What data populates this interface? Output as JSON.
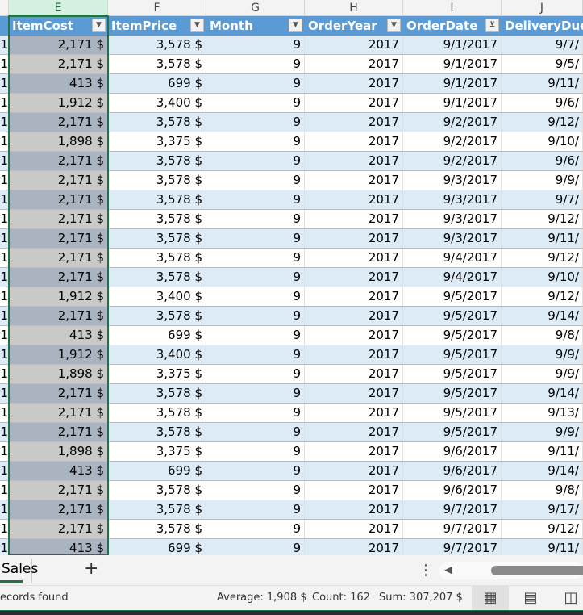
{
  "columns": [
    "",
    "E",
    "F",
    "G",
    "H",
    "I",
    "J"
  ],
  "headers": [
    "",
    "ItemCost",
    "ItemPrice",
    "Month",
    "OrderYear",
    "OrderDate",
    "DeliveryDueD"
  ],
  "filter_icons": [
    "dropdown-icon",
    "dropdown-icon",
    "dropdown-icon",
    "dropdown-icon",
    "filter-active-icon"
  ],
  "rows": [
    [
      "1",
      "2,171 $",
      "3,578 $",
      "9",
      "2017",
      "9/1/2017",
      "9/7/"
    ],
    [
      "1",
      "2,171 $",
      "3,578 $",
      "9",
      "2017",
      "9/1/2017",
      "9/5/"
    ],
    [
      "1",
      "413 $",
      "699 $",
      "9",
      "2017",
      "9/1/2017",
      "9/11/"
    ],
    [
      "1",
      "1,912 $",
      "3,400 $",
      "9",
      "2017",
      "9/1/2017",
      "9/6/"
    ],
    [
      "1",
      "2,171 $",
      "3,578 $",
      "9",
      "2017",
      "9/2/2017",
      "9/12/"
    ],
    [
      "1",
      "1,898 $",
      "3,375 $",
      "9",
      "2017",
      "9/2/2017",
      "9/10/"
    ],
    [
      "1",
      "2,171 $",
      "3,578 $",
      "9",
      "2017",
      "9/2/2017",
      "9/6/"
    ],
    [
      "1",
      "2,171 $",
      "3,578 $",
      "9",
      "2017",
      "9/3/2017",
      "9/9/"
    ],
    [
      "1",
      "2,171 $",
      "3,578 $",
      "9",
      "2017",
      "9/3/2017",
      "9/7/"
    ],
    [
      "1",
      "2,171 $",
      "3,578 $",
      "9",
      "2017",
      "9/3/2017",
      "9/12/"
    ],
    [
      "1",
      "2,171 $",
      "3,578 $",
      "9",
      "2017",
      "9/3/2017",
      "9/11/"
    ],
    [
      "1",
      "2,171 $",
      "3,578 $",
      "9",
      "2017",
      "9/4/2017",
      "9/12/"
    ],
    [
      "1",
      "2,171 $",
      "3,578 $",
      "9",
      "2017",
      "9/4/2017",
      "9/10/"
    ],
    [
      "1",
      "1,912 $",
      "3,400 $",
      "9",
      "2017",
      "9/5/2017",
      "9/12/"
    ],
    [
      "1",
      "2,171 $",
      "3,578 $",
      "9",
      "2017",
      "9/5/2017",
      "9/14/"
    ],
    [
      "1",
      "413 $",
      "699 $",
      "9",
      "2017",
      "9/5/2017",
      "9/8/"
    ],
    [
      "1",
      "1,912 $",
      "3,400 $",
      "9",
      "2017",
      "9/5/2017",
      "9/9/"
    ],
    [
      "1",
      "1,898 $",
      "3,375 $",
      "9",
      "2017",
      "9/5/2017",
      "9/9/"
    ],
    [
      "1",
      "2,171 $",
      "3,578 $",
      "9",
      "2017",
      "9/5/2017",
      "9/14/"
    ],
    [
      "1",
      "2,171 $",
      "3,578 $",
      "9",
      "2017",
      "9/5/2017",
      "9/13/"
    ],
    [
      "1",
      "2,171 $",
      "3,578 $",
      "9",
      "2017",
      "9/5/2017",
      "9/9/"
    ],
    [
      "1",
      "1,898 $",
      "3,375 $",
      "9",
      "2017",
      "9/6/2017",
      "9/11/"
    ],
    [
      "1",
      "413 $",
      "699 $",
      "9",
      "2017",
      "9/6/2017",
      "9/14/"
    ],
    [
      "1",
      "2,171 $",
      "3,578 $",
      "9",
      "2017",
      "9/6/2017",
      "9/8/"
    ],
    [
      "1",
      "2,171 $",
      "3,578 $",
      "9",
      "2017",
      "9/7/2017",
      "9/17/"
    ],
    [
      "1",
      "2,171 $",
      "3,578 $",
      "9",
      "2017",
      "9/7/2017",
      "9/12/"
    ],
    [
      "1",
      "413 $",
      "699 $",
      "9",
      "2017",
      "9/7/2017",
      "9/11/"
    ]
  ],
  "sheet_tab": "Sales",
  "add_sheet": "+",
  "more": "⋮",
  "status": {
    "left": "ecords found",
    "average": "Average: 1,908 $",
    "count": "Count: 162",
    "sum": "Sum: 307,207 $"
  },
  "views": {
    "normal": "▦",
    "page_layout": "▤",
    "page_break": "◫"
  }
}
